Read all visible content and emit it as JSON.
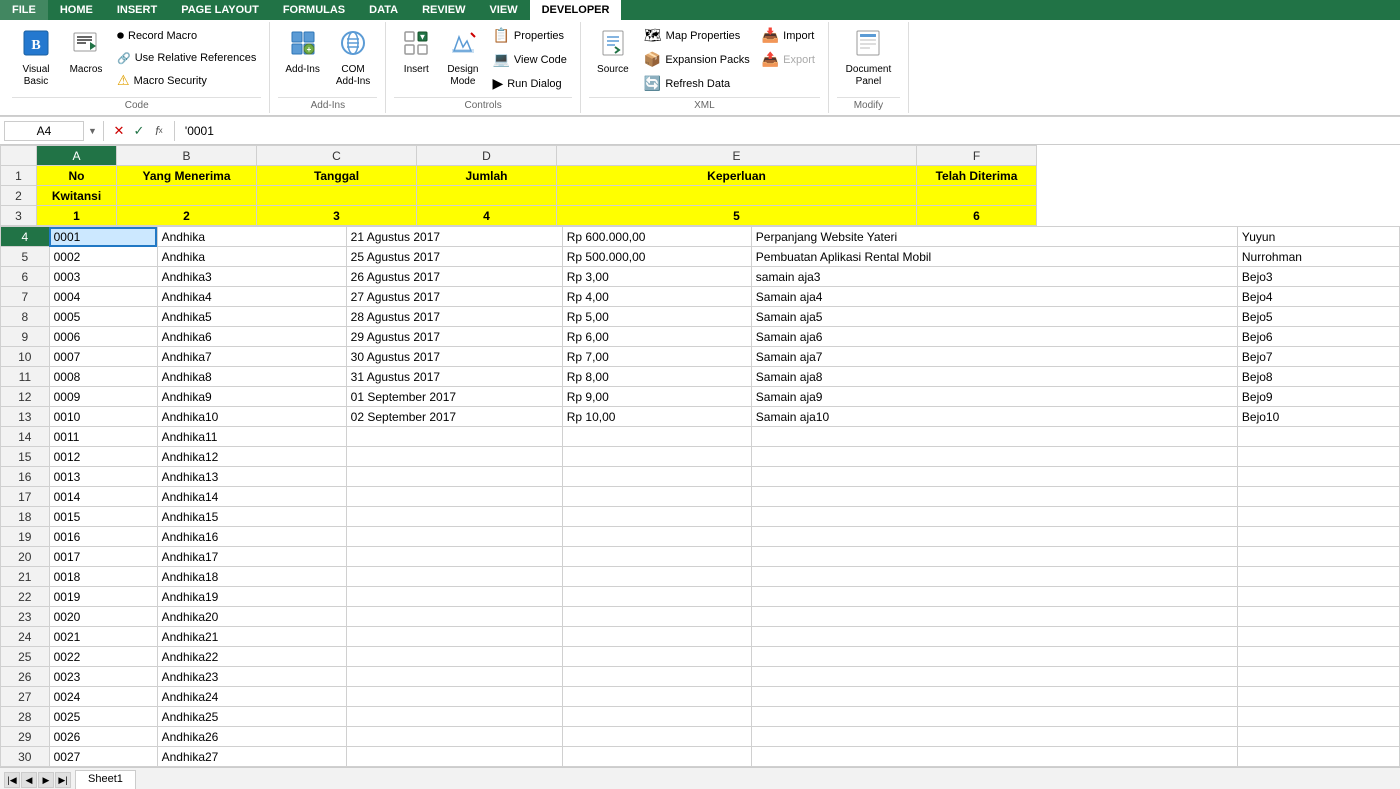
{
  "ribbon": {
    "tabs": [
      "FILE",
      "HOME",
      "INSERT",
      "PAGE LAYOUT",
      "FORMULAS",
      "DATA",
      "REVIEW",
      "VIEW",
      "DEVELOPER"
    ],
    "active_tab": "DEVELOPER",
    "groups": {
      "code": {
        "label": "Code",
        "buttons": [
          {
            "id": "record-macro",
            "label": "Record Macro",
            "icon": "⏺"
          },
          {
            "id": "use-relative",
            "label": "Use Relative References",
            "icon": "🔗"
          },
          {
            "id": "macro-security",
            "label": "Macro Security",
            "icon": "⚠"
          }
        ],
        "large_btn": {
          "id": "visual-basic",
          "label": "Visual Basic",
          "icon": "📝"
        },
        "macros_btn": {
          "id": "macros",
          "label": "Macros",
          "icon": "📋"
        }
      },
      "add_ins": {
        "label": "Add-Ins",
        "buttons": [
          {
            "id": "add-ins",
            "label": "Add-Ins",
            "icon": "🔧"
          },
          {
            "id": "com-add-ins",
            "label": "COM Add-Ins",
            "icon": "⚙"
          }
        ]
      },
      "controls": {
        "label": "Controls",
        "buttons": [
          {
            "id": "insert",
            "label": "Insert",
            "icon": "📌"
          },
          {
            "id": "design-mode",
            "label": "Design Mode",
            "icon": "📐"
          },
          {
            "id": "properties",
            "label": "Properties",
            "icon": "📋"
          },
          {
            "id": "view-code",
            "label": "View Code",
            "icon": "💻"
          },
          {
            "id": "run-dialog",
            "label": "Run Dialog",
            "icon": "▶"
          }
        ]
      },
      "xml": {
        "label": "XML",
        "buttons": [
          {
            "id": "source",
            "label": "Source",
            "icon": "🗂"
          },
          {
            "id": "map-properties",
            "label": "Map Properties",
            "icon": "🗺"
          },
          {
            "id": "expansion-packs",
            "label": "Expansion Packs",
            "icon": "📦"
          },
          {
            "id": "refresh-data",
            "label": "Refresh Data",
            "icon": "🔄"
          },
          {
            "id": "import",
            "label": "Import",
            "icon": "📥"
          },
          {
            "id": "export",
            "label": "Export",
            "icon": "📤"
          }
        ]
      },
      "modify": {
        "label": "Modify",
        "buttons": [
          {
            "id": "document-panel",
            "label": "Document Panel",
            "icon": "📄"
          }
        ]
      }
    }
  },
  "formula_bar": {
    "cell_ref": "A4",
    "formula": "'0001"
  },
  "spreadsheet": {
    "col_headers": [
      "",
      "A",
      "B",
      "C",
      "D",
      "E",
      "F"
    ],
    "headers_row1": [
      "",
      "No",
      "Yang Menerima",
      "Tanggal",
      "Jumlah",
      "Keperluan",
      "Telah Diterima"
    ],
    "headers_row2": [
      "",
      "Kwitansi",
      "",
      "",
      "",
      "",
      ""
    ],
    "number_row": [
      "",
      "1",
      "2",
      "3",
      "4",
      "5",
      "6"
    ],
    "rows": [
      {
        "num": 4,
        "a": "0001",
        "b": "Andhika",
        "c": "21 Agustus 2017",
        "d": "Rp    600.000,00",
        "e": "Perpanjang Website Yateri",
        "f": "Yuyun",
        "selected": true
      },
      {
        "num": 5,
        "a": "0002",
        "b": "Andhika",
        "c": "25 Agustus 2017",
        "d": "Rp    500.000,00",
        "e": "Pembuatan Aplikasi Rental Mobil",
        "f": "Nurrohman"
      },
      {
        "num": 6,
        "a": "0003",
        "b": "Andhika3",
        "c": "26 Agustus 2017",
        "d": "Rp         3,00",
        "e": "samain aja3",
        "f": "Bejo3"
      },
      {
        "num": 7,
        "a": "0004",
        "b": "Andhika4",
        "c": "27 Agustus 2017",
        "d": "Rp         4,00",
        "e": "Samain aja4",
        "f": "Bejo4"
      },
      {
        "num": 8,
        "a": "0005",
        "b": "Andhika5",
        "c": "28 Agustus 2017",
        "d": "Rp         5,00",
        "e": "Samain aja5",
        "f": "Bejo5"
      },
      {
        "num": 9,
        "a": "0006",
        "b": "Andhika6",
        "c": "29 Agustus 2017",
        "d": "Rp         6,00",
        "e": "Samain aja6",
        "f": "Bejo6"
      },
      {
        "num": 10,
        "a": "0007",
        "b": "Andhika7",
        "c": "30 Agustus 2017",
        "d": "Rp         7,00",
        "e": "Samain aja7",
        "f": "Bejo7"
      },
      {
        "num": 11,
        "a": "0008",
        "b": "Andhika8",
        "c": "31 Agustus 2017",
        "d": "Rp         8,00",
        "e": "Samain aja8",
        "f": "Bejo8"
      },
      {
        "num": 12,
        "a": "0009",
        "b": "Andhika9",
        "c": "01 September 2017",
        "d": "Rp         9,00",
        "e": "Samain aja9",
        "f": "Bejo9"
      },
      {
        "num": 13,
        "a": "0010",
        "b": "Andhika10",
        "c": "02 September 2017",
        "d": "Rp        10,00",
        "e": "Samain aja10",
        "f": "Bejo10"
      },
      {
        "num": 14,
        "a": "0011",
        "b": "Andhika11",
        "c": "",
        "d": "",
        "e": "",
        "f": ""
      },
      {
        "num": 15,
        "a": "0012",
        "b": "Andhika12",
        "c": "",
        "d": "",
        "e": "",
        "f": ""
      },
      {
        "num": 16,
        "a": "0013",
        "b": "Andhika13",
        "c": "",
        "d": "",
        "e": "",
        "f": ""
      },
      {
        "num": 17,
        "a": "0014",
        "b": "Andhika14",
        "c": "",
        "d": "",
        "e": "",
        "f": ""
      },
      {
        "num": 18,
        "a": "0015",
        "b": "Andhika15",
        "c": "",
        "d": "",
        "e": "",
        "f": ""
      },
      {
        "num": 19,
        "a": "0016",
        "b": "Andhika16",
        "c": "",
        "d": "",
        "e": "",
        "f": ""
      },
      {
        "num": 20,
        "a": "0017",
        "b": "Andhika17",
        "c": "",
        "d": "",
        "e": "",
        "f": ""
      },
      {
        "num": 21,
        "a": "0018",
        "b": "Andhika18",
        "c": "",
        "d": "",
        "e": "",
        "f": ""
      },
      {
        "num": 22,
        "a": "0019",
        "b": "Andhika19",
        "c": "",
        "d": "",
        "e": "",
        "f": ""
      },
      {
        "num": 23,
        "a": "0020",
        "b": "Andhika20",
        "c": "",
        "d": "",
        "e": "",
        "f": ""
      },
      {
        "num": 24,
        "a": "0021",
        "b": "Andhika21",
        "c": "",
        "d": "",
        "e": "",
        "f": ""
      },
      {
        "num": 25,
        "a": "0022",
        "b": "Andhika22",
        "c": "",
        "d": "",
        "e": "",
        "f": ""
      },
      {
        "num": 26,
        "a": "0023",
        "b": "Andhika23",
        "c": "",
        "d": "",
        "e": "",
        "f": ""
      },
      {
        "num": 27,
        "a": "0024",
        "b": "Andhika24",
        "c": "",
        "d": "",
        "e": "",
        "f": ""
      },
      {
        "num": 28,
        "a": "0025",
        "b": "Andhika25",
        "c": "",
        "d": "",
        "e": "",
        "f": ""
      },
      {
        "num": 29,
        "a": "0026",
        "b": "Andhika26",
        "c": "",
        "d": "",
        "e": "",
        "f": ""
      },
      {
        "num": 30,
        "a": "0027",
        "b": "Andhika27",
        "c": "",
        "d": "",
        "e": "",
        "f": ""
      }
    ],
    "sheet_tab": "Sheet1"
  },
  "colors": {
    "excel_green": "#217346",
    "tab_active": "#217346",
    "yellow": "#ffff00",
    "selected_cell": "#cce8ff",
    "selected_border": "#2178c4"
  }
}
